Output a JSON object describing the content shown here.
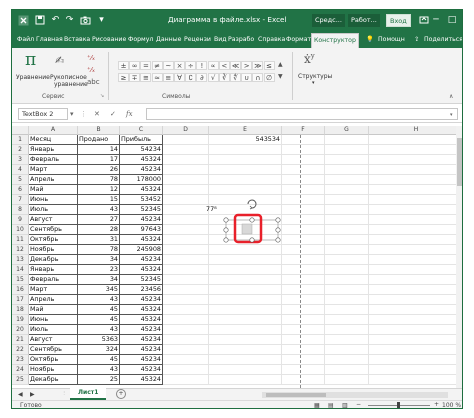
{
  "window": {
    "title": "Диаграмма в файле.xlsx  -  Excel",
    "tool_label_1": "Средс...",
    "tool_label_2": "Работ...",
    "signin": "Вход",
    "min_glyph": "─",
    "max_glyph": "□",
    "close_glyph": "✕"
  },
  "tabs": [
    "Файл",
    "Главная",
    "Вставка",
    "Рисование",
    "Формул",
    "Данные",
    "Рецензи",
    "Вид",
    "Разрабо",
    "Справка",
    "Формат",
    "Конструктор"
  ],
  "tabs_active": "Конструктор",
  "help_label": "Помощн",
  "share_label": "Поделиться",
  "ribbon": {
    "pi_glyph": "π",
    "equation_label": "Уравнение",
    "handwritten_label": "Рукописное",
    "handwritten_label2": "уравнение",
    "group_service": "Сервис",
    "group_symbols": "Символы",
    "structures_label": "Структуры",
    "symbols_row1": [
      "±",
      "∞",
      "=",
      "≠",
      "~",
      "×",
      "÷",
      "!",
      "∝",
      "<",
      "≪",
      ">",
      "≫",
      "≤"
    ],
    "symbols_row2": [
      "≥",
      "∓",
      "≅",
      "≈",
      "≡",
      "∀",
      "∁",
      "∂",
      "√",
      "∛",
      "∜",
      "∪",
      "∩",
      "∅"
    ]
  },
  "formula_bar": {
    "name_box": "TextBox 2",
    "fx_glyph": "fx",
    "cancel_glyph": "✕",
    "enter_glyph": "✓",
    "formula": ""
  },
  "grid": {
    "columns": [
      "A",
      "B",
      "C",
      "D",
      "E",
      "F",
      "G",
      "H"
    ],
    "row_numbers": [
      "1",
      "2",
      "3",
      "4",
      "5",
      "6",
      "7",
      "8",
      "9",
      "10",
      "11",
      "12",
      "13",
      "14",
      "15",
      "16",
      "17",
      "18",
      "19",
      "20",
      "21",
      "22",
      "23",
      "24",
      "25"
    ],
    "headers": [
      "Месяц",
      "Продано",
      "Прибыль"
    ],
    "rows": [
      [
        "Январь",
        "14",
        "54234"
      ],
      [
        "Февраль",
        "17",
        "45324"
      ],
      [
        "Март",
        "26",
        "45234"
      ],
      [
        "Апрель",
        "78",
        "178000"
      ],
      [
        "Май",
        "12",
        "45324"
      ],
      [
        "Июнь",
        "15",
        "53452"
      ],
      [
        "Июль",
        "43",
        "52345"
      ],
      [
        "Август",
        "27",
        "45234"
      ],
      [
        "Сентябрь",
        "28",
        "97643"
      ],
      [
        "Октябрь",
        "31",
        "45324"
      ],
      [
        "Ноябрь",
        "78",
        "245908"
      ],
      [
        "Декабрь",
        "34",
        "45234"
      ],
      [
        "Январь",
        "23",
        "45324"
      ],
      [
        "Февраль",
        "34",
        "52345"
      ],
      [
        "Март",
        "345",
        "23456"
      ],
      [
        "Апрель",
        "43",
        "45234"
      ],
      [
        "Май",
        "45",
        "45324"
      ],
      [
        "Июнь",
        "45",
        "45324"
      ],
      [
        "Июль",
        "43",
        "45234"
      ],
      [
        "Август",
        "5363",
        "45234"
      ],
      [
        "Сентябрь",
        "324",
        "45234"
      ],
      [
        "Октябрь",
        "45",
        "45234"
      ],
      [
        "Ноябрь",
        "43",
        "45234"
      ],
      [
        "Декабрь",
        "25",
        "45324"
      ]
    ],
    "e1_value": "543534",
    "d8_text": "77⁸",
    "textbox_glyph": "□"
  },
  "sheets": [
    "Лист1"
  ],
  "add_sheet_glyph": "+",
  "status": {
    "ready": "Готово",
    "zoom": "100 %"
  },
  "colors": {
    "excel_green": "#217346",
    "highlight_red": "#e8202a"
  }
}
